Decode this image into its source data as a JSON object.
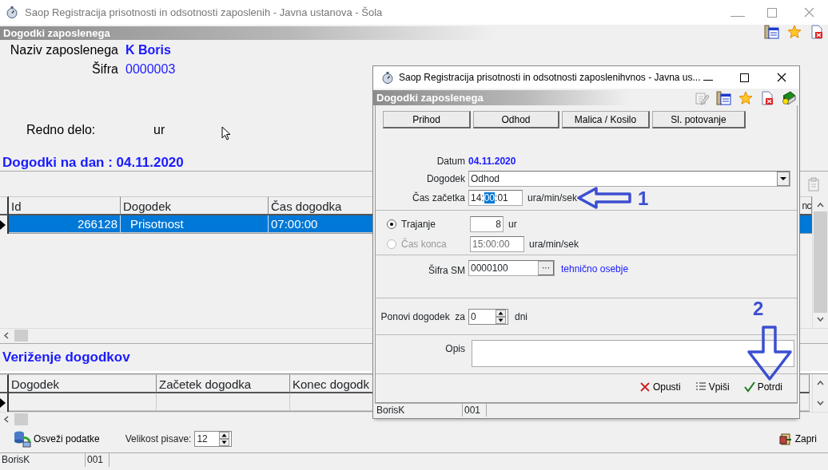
{
  "main_window": {
    "title": "Saop Registracija prisotnosti in odsotnosti zaposlenih - Javna ustanova - Šola",
    "section_title": "Dogodki zaposlenega",
    "employee": [
      {
        "label": "Naziv zaposlenega",
        "value": "K Boris",
        "kind": "name"
      },
      {
        "label": "Šifra",
        "value": "0000003",
        "kind": "code"
      }
    ],
    "regular_work": {
      "label": "Redno delo:",
      "unit": "ur"
    },
    "events_heading": "Dogodki na dan : 04.11.2020",
    "events_table": {
      "columns": [
        "Id",
        "Dogodek",
        "Čas dogodka",
        "nc"
      ],
      "rows": [
        {
          "cells": [
            "266128",
            "Prisotnost",
            "07:00:00"
          ],
          "selected": true,
          "current": true
        }
      ]
    },
    "chain_heading": "Veriženje dogodkov",
    "chain_table": {
      "columns": [
        "Dogodek",
        "Začetek dogodka",
        "Konec dogodk"
      ],
      "rows": [
        {
          "current": true
        }
      ]
    },
    "refresh_button": "Osveži podatke",
    "font_size": {
      "label": "Velikost pisave:",
      "value": "12"
    },
    "close_button": "Zapri",
    "status_bar": [
      "BorisK",
      "001"
    ]
  },
  "dialog": {
    "title": "Saop Registracija prisotnosti in odsotnosti zaposlenihvnos - Javna us...",
    "section_title": "Dogodki zaposlenega",
    "event_buttons": [
      "Prihod",
      "Odhod",
      "Malica / Kosilo",
      "Sl. potovanje"
    ],
    "date": {
      "label": "Datum",
      "value": "04.11.2020"
    },
    "event": {
      "label": "Dogodek",
      "value": "Odhod"
    },
    "start_time": {
      "label": "Čas začetka",
      "before": "14:",
      "selected": "00",
      "after": ":01",
      "unit": "ura/min/sek"
    },
    "duration_options": [
      {
        "label": "Trajanje",
        "value": "8",
        "unit": "ur",
        "selected": true,
        "disabled": false
      },
      {
        "label": "Čas konca",
        "value": "15:00:00",
        "unit": "ura/min/sek",
        "selected": false,
        "disabled": true
      }
    ],
    "cost_center": {
      "label": "Šifra SM",
      "value": "0000100",
      "button": "···",
      "description": "tehnično osebje"
    },
    "repeat": {
      "label": "Ponovi dogodek  za",
      "value": "0",
      "unit": "dni"
    },
    "description": {
      "label": "Opis"
    },
    "actions": [
      "Opusti",
      "Vpiši",
      "Potrdi"
    ],
    "status_bar": [
      "BorisK",
      "001"
    ]
  },
  "annotations": [
    {
      "number": "1",
      "kind": "left"
    },
    {
      "number": "2",
      "kind": "down"
    }
  ]
}
